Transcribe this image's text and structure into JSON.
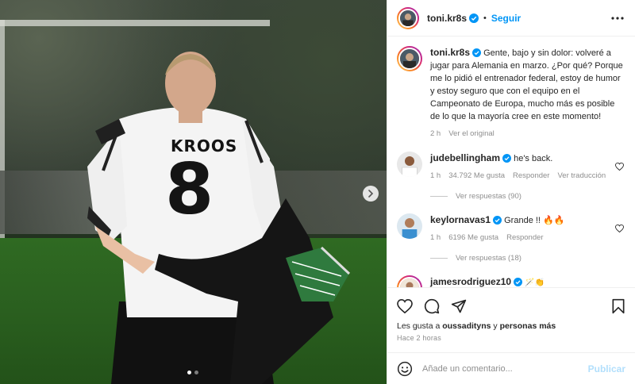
{
  "author": {
    "username": "toni.kr8s",
    "follow_label": "Seguir"
  },
  "media": {
    "jersey_name": "KROOS",
    "jersey_number": "8",
    "carousel_total": 2,
    "carousel_index": 1
  },
  "caption": {
    "username": "toni.kr8s",
    "text": "Gente, bajo y sin dolor: volveré a jugar para Alemania en marzo. ¿Por qué? Porque me lo pidió el entrenador federal, estoy de humor y estoy seguro que con el equipo en el Campeonato de Europa, mucho más es posible de lo que la mayoría cree en este momento!",
    "time": "2 h",
    "see_original": "Ver el original"
  },
  "comments": [
    {
      "username": "judebellingham",
      "text": "he's back.",
      "time": "1 h",
      "likes": "34.792 Me gusta",
      "reply": "Responder",
      "translate": "Ver traducción",
      "view_replies": "Ver respuestas (90)"
    },
    {
      "username": "keylornavas1",
      "text": "Grande !! 🔥🔥",
      "time": "1 h",
      "likes": "6196 Me gusta",
      "reply": "Responder",
      "view_replies": "Ver respuestas (18)"
    },
    {
      "username": "jamesrodriguez10",
      "text": "🪄👏"
    }
  ],
  "likes": {
    "prefix": "Les gusta a ",
    "user": "oussadityns",
    "middle": " y ",
    "others": "personas más"
  },
  "posted_ago": "Hace 2 horas",
  "add_comment": {
    "placeholder": "Añade un comentario...",
    "publish": "Publicar"
  },
  "colors": {
    "accent": "#0095f6",
    "publish_disabled": "#b2dffc",
    "text": "#262626",
    "muted": "#8e8e8e"
  }
}
